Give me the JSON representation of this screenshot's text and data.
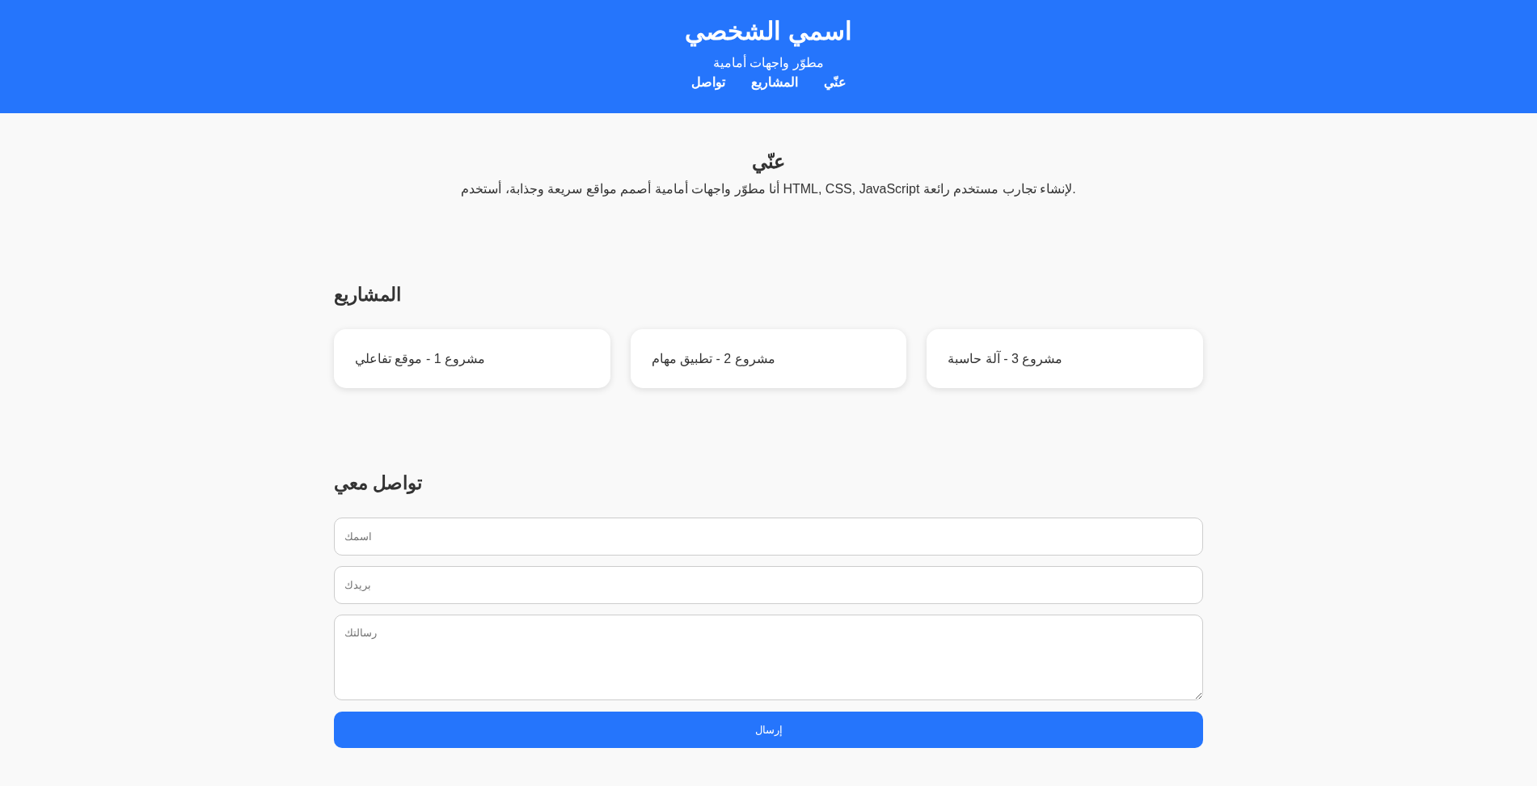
{
  "header": {
    "title": "اسمي الشخصي",
    "subtitle": "مطوّر واجهات أمامية",
    "nav": [
      {
        "label": "عنّي"
      },
      {
        "label": "المشاريع"
      },
      {
        "label": "تواصل"
      }
    ]
  },
  "about": {
    "heading": "عنّي",
    "text": "أنا مطوّر واجهات أمامية أصمم مواقع سريعة وجذابة، أستخدم HTML, CSS, JavaScript لإنشاء تجارب مستخدم رائعة."
  },
  "projects": {
    "heading": "المشاريع",
    "items": [
      {
        "title": "مشروع 3 - آلة حاسبة"
      },
      {
        "title": "مشروع 2 - تطبيق مهام"
      },
      {
        "title": "مشروع 1 - موقع تفاعلي"
      }
    ]
  },
  "contact": {
    "heading": "تواصل معي",
    "fields": [
      {
        "kind": "input",
        "placeholder": "اسمك"
      },
      {
        "kind": "input",
        "placeholder": "بريدك"
      },
      {
        "kind": "textarea",
        "placeholder": "رسالتك"
      }
    ],
    "submit": "إرسال"
  }
}
